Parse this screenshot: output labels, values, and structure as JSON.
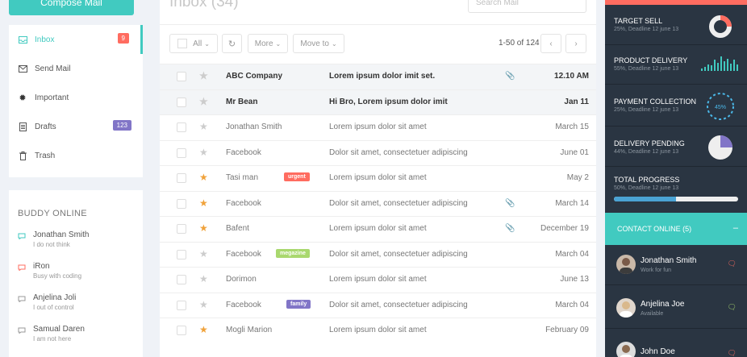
{
  "compose_label": "Compose Mail",
  "folders": [
    {
      "label": "Inbox",
      "badge": "9",
      "badge_color": "#ff6c60"
    },
    {
      "label": "Send Mail"
    },
    {
      "label": "Important"
    },
    {
      "label": "Drafts",
      "badge": "123",
      "badge_color": "#8175c7"
    },
    {
      "label": "Trash"
    }
  ],
  "buddy": {
    "title": "BUDDY ONLINE",
    "items": [
      {
        "name": "Jonathan Smith",
        "status": "I do not think",
        "color": "#41cac0"
      },
      {
        "name": "iRon",
        "status": "Busy with coding",
        "color": "#ff6c60"
      },
      {
        "name": "Anjelina Joli",
        "status": "I out of control",
        "color": "#999999"
      },
      {
        "name": "Samual Daren",
        "status": "I am not here",
        "color": "#999999"
      }
    ]
  },
  "inbox": {
    "title": "Inbox (34)",
    "search_placeholder": "Search Mail",
    "toolbar": {
      "all": "All",
      "more": "More",
      "move_to": "Move to"
    },
    "pager": "1-50 of 124",
    "rows": [
      {
        "sender": "ABC Company",
        "subject": "Lorem ipsum dolor imit set.",
        "date": "12.10 AM",
        "unread": true,
        "starred": false,
        "attach": true
      },
      {
        "sender": "Mr Bean",
        "subject": "Hi Bro, Lorem ipsum dolor imit",
        "date": "Jan 11",
        "unread": true,
        "starred": false,
        "attach": false
      },
      {
        "sender": "Jonathan Smith",
        "subject": "Lorem ipsum dolor sit amet",
        "date": "March 15",
        "unread": false,
        "starred": false,
        "attach": false
      },
      {
        "sender": "Facebook",
        "subject": "Dolor sit amet, consectetuer adipiscing",
        "date": "June 01",
        "unread": false,
        "starred": false,
        "attach": false
      },
      {
        "sender": "Tasi man",
        "subject": "Lorem ipsum dolor sit amet",
        "date": "May 2",
        "unread": false,
        "starred": true,
        "attach": false,
        "tag": "urgent",
        "tag_color": "#ff6c60"
      },
      {
        "sender": "Facebook",
        "subject": "Dolor sit amet, consectetuer adipiscing",
        "date": "March 14",
        "unread": false,
        "starred": true,
        "attach": true
      },
      {
        "sender": "Bafent",
        "subject": "Lorem ipsum dolor sit amet",
        "date": "December 19",
        "unread": false,
        "starred": true,
        "attach": true
      },
      {
        "sender": "Facebook",
        "subject": "Dolor sit amet, consectetuer adipiscing",
        "date": "March 04",
        "unread": false,
        "starred": false,
        "attach": false,
        "tag": "megazine",
        "tag_color": "#a9d86e"
      },
      {
        "sender": "Dorimon",
        "subject": "Lorem ipsum dolor sit amet",
        "date": "June 13",
        "unread": false,
        "starred": false,
        "attach": false
      },
      {
        "sender": "Facebook",
        "subject": "Dolor sit amet, consectetuer adipiscing",
        "date": "March 04",
        "unread": false,
        "starred": false,
        "attach": false,
        "tag": "family",
        "tag_color": "#8175c7"
      },
      {
        "sender": "Mogli Marion",
        "subject": "Lorem ipsum dolor sit amet",
        "date": "February 09",
        "unread": false,
        "starred": true,
        "attach": false
      }
    ]
  },
  "stats": [
    {
      "title": "TARGET SELL",
      "sub": "25%, Deadline 12 june 13"
    },
    {
      "title": "PRODUCT DELIVERY",
      "sub": "55%, Deadline 12 june 13"
    },
    {
      "title": "PAYMENT COLLECTION",
      "sub": "25%, Deadline 12 june 13",
      "value": "45%"
    },
    {
      "title": "DELIVERY PENDING",
      "sub": "44%, Deadline 12 june 13"
    },
    {
      "title": "TOTAL PROGRESS",
      "sub": "50%, Deadline 12 june 13",
      "progress": 0.5
    }
  ],
  "contacts": {
    "title": "CONTACT ONLINE (5)",
    "items": [
      {
        "name": "Jonathan Smith",
        "status": "Work for fun",
        "color": "#ff6c60"
      },
      {
        "name": "Anjelina Joe",
        "status": "Available",
        "color": "#a9d86e"
      },
      {
        "name": "John Doe",
        "status": "",
        "color": "#ff6c60"
      }
    ]
  }
}
